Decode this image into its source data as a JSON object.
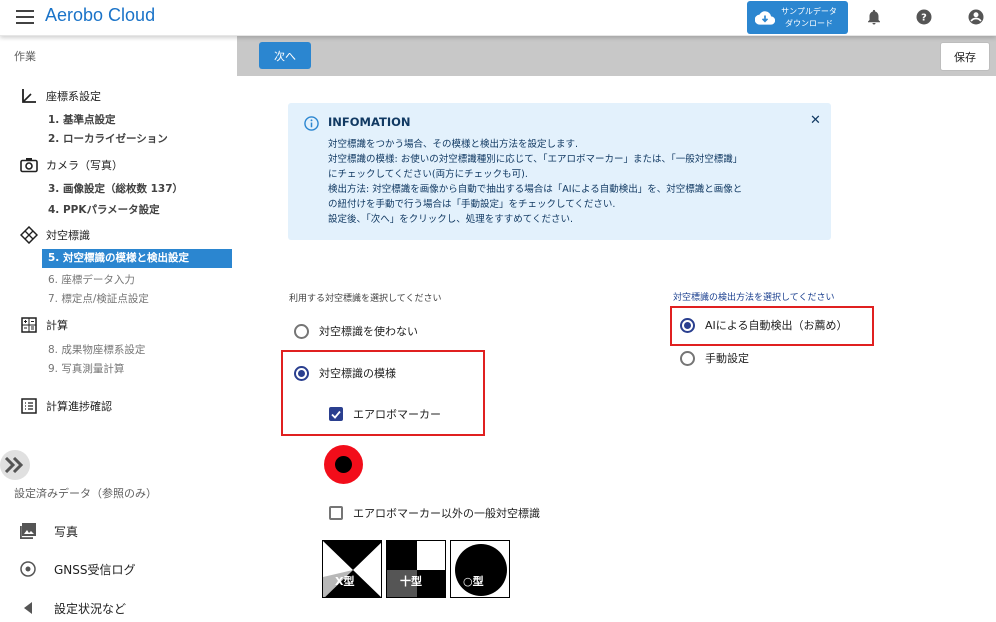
{
  "app": {
    "title": "Aerobo Cloud"
  },
  "header": {
    "sample_download": [
      "サンプルデータ",
      "ダウンロード"
    ]
  },
  "sidebar": {
    "section_work": "作業",
    "groups": [
      {
        "label": "座標系設定",
        "items": [
          "1. 基準点設定",
          "2. ローカライゼーション"
        ]
      },
      {
        "label": "カメラ（写真）",
        "items": [
          "3. 画像設定（総枚数 137）",
          "4. PPKパラメータ設定"
        ]
      },
      {
        "label": "対空標識",
        "items": [
          "5. 対空標識の模様と検出設定",
          "6. 座標データ入力",
          "7. 標定点/検証点設定"
        ]
      },
      {
        "label": "計算",
        "items": [
          "8. 成果物座標系設定",
          "9. 写真測量計算"
        ]
      },
      {
        "label": "計算進捗確認",
        "items": []
      }
    ],
    "section_reference": "設定済みデータ（参照のみ）",
    "data_items": [
      "写真",
      "GNSS受信ログ",
      "設定状況など"
    ]
  },
  "actions": {
    "next_label": "次へ",
    "save_label": "保存"
  },
  "info": {
    "title": "INFOMATION",
    "lines": [
      "対空標識をつかう場合、その模様と検出方法を設定します.",
      "対空標識の模様: お使いの対空標識種別に応じて、「エアロボマーカー」または、「一般対空標識」",
      "にチェックしてください(両方にチェックも可).",
      "検出方法: 対空標識を画像から自動で抽出する場合は「AIによる自動検出」を、対空標識と画像と",
      "の紐付けを手動で行う場合は「手動設定」をチェックしてください.",
      "設定後、「次へ」をクリックし、処理をすすめてください."
    ]
  },
  "marker_select": {
    "label": "利用する対空標識を選択してください",
    "options": [
      "対空標識を使わない",
      "対空標識の模様"
    ],
    "selected": "対空標識の模様",
    "checkboxes": [
      {
        "label": "エアロボマーカー",
        "checked": true
      },
      {
        "label": "エアロボマーカー以外の一般対空標識",
        "checked": false
      }
    ],
    "marker_types": [
      "X型",
      "十型",
      "○型"
    ]
  },
  "detection_select": {
    "label": "対空標識の検出方法を選択してください",
    "options": [
      "AIによる自動検出（お薦め）",
      "手動設定"
    ],
    "selected": "AIによる自動検出（お薦め）"
  },
  "colors": {
    "accent": "#2b86d0",
    "highlight": "#e02020",
    "radio": "#2a3f8f",
    "info_bg": "#e3f1fc"
  }
}
